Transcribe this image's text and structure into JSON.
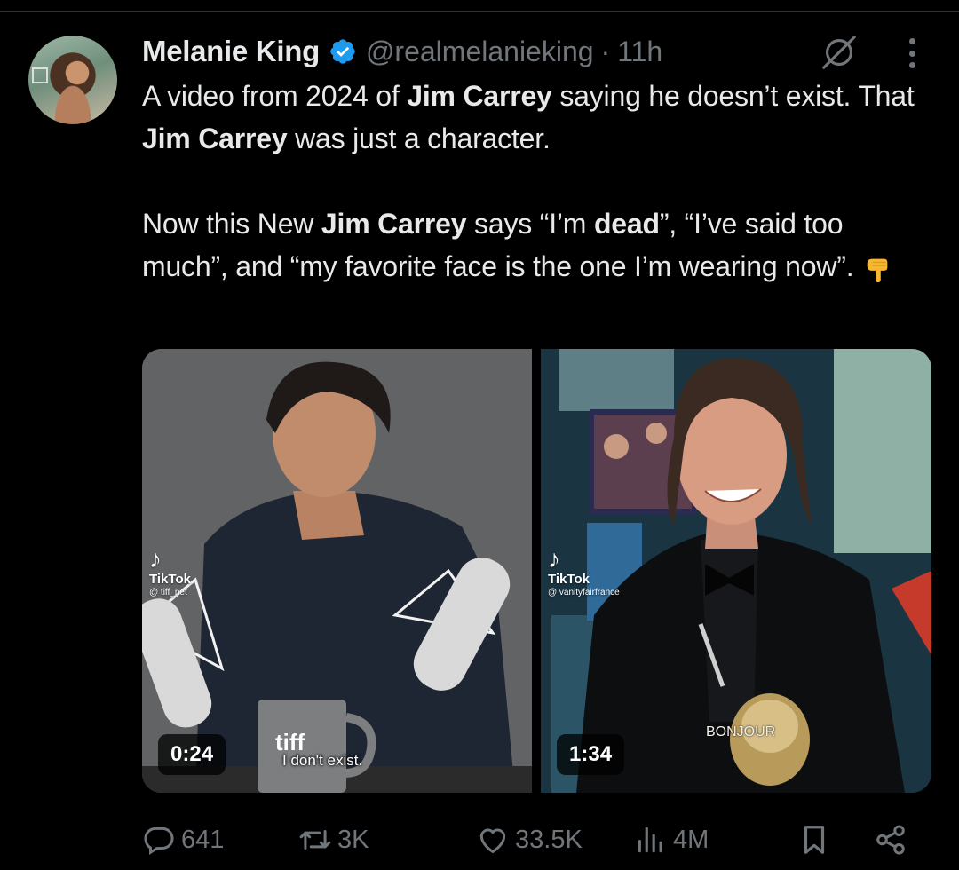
{
  "author": {
    "name": "Melanie King",
    "handle": "@realmelanieking",
    "separator": "·",
    "time": "11h",
    "verified_color": "#1d9bf0"
  },
  "tweet": {
    "line1_a": "A video from 2024 of ",
    "line1_b": "Jim Carrey",
    "line1_c": " saying he doesn’t exist. That ",
    "line1_d": "Jim Carrey",
    "line1_e": " was just a character.",
    "line2_a": "Now this New ",
    "line2_b": "Jim Carrey",
    "line2_c": " says “I’m ",
    "line2_d": "dead",
    "line2_e": "”, “I’ve said too much”, and “my favorite face is the one I’m wearing now”."
  },
  "media": [
    {
      "tiktok_label": "TikTok",
      "tiktok_user": "@ tiff_net",
      "duration": "0:24",
      "caption": "I don't exist.",
      "mug_text": "tiff"
    },
    {
      "tiktok_label": "TikTok",
      "tiktok_user": "@ vanityfairfrance",
      "duration": "1:34",
      "sign_text": "BONJOUR"
    }
  ],
  "actions": {
    "replies": "641",
    "reposts": "3K",
    "likes": "33.5K",
    "views": "4M"
  },
  "icons": [
    "verified-badge-icon",
    "grok-icon",
    "more-icon",
    "pointing-down-emoji",
    "reply-icon",
    "repost-icon",
    "like-icon",
    "views-icon",
    "bookmark-icon",
    "share-icon",
    "tiktok-logo-icon"
  ],
  "colors": {
    "background": "#000000",
    "text": "#e7e9ea",
    "secondary": "#71767b",
    "accent": "#1d9bf0"
  }
}
